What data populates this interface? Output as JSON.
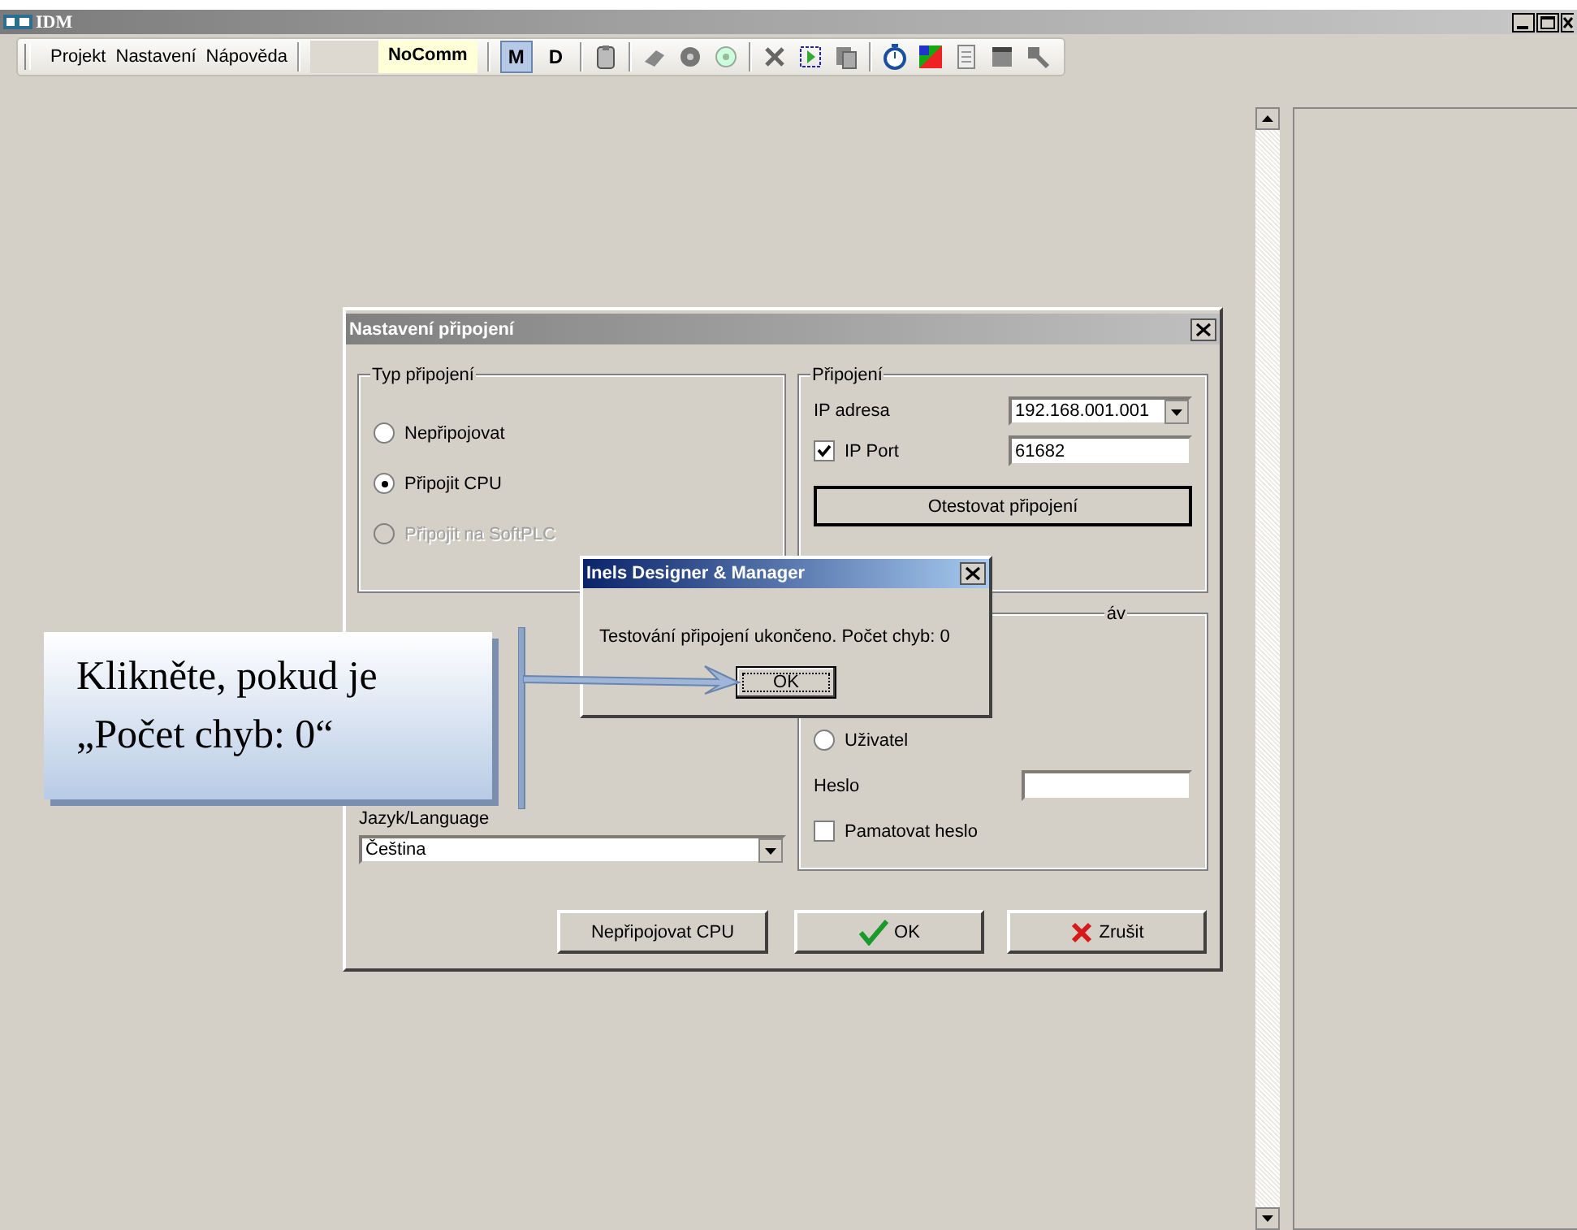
{
  "window": {
    "title": "IDM"
  },
  "menu": [
    {
      "label": "Projekt"
    },
    {
      "label": "Nastavení"
    },
    {
      "label": "Nápověda"
    }
  ],
  "comm_status": "NoComm",
  "mode_buttons": [
    {
      "label": "M",
      "selected": true
    },
    {
      "label": "D",
      "selected": false
    }
  ],
  "dialog": {
    "title": "Nastavení připojení",
    "connection_type": {
      "title": "Typ připojení",
      "options": [
        {
          "label": "Nepřipojovat",
          "selected": false,
          "disabled": false
        },
        {
          "label": "Připojit CPU",
          "selected": true,
          "disabled": false
        },
        {
          "label": "Připojit na SoftPLC",
          "selected": false,
          "disabled": true
        }
      ]
    },
    "connection": {
      "title": "Připojení",
      "ip_label": "IP adresa",
      "ip_value": "192.168.001.001",
      "port": {
        "label": "IP Port",
        "checked": true,
        "value": "61682"
      },
      "test_button": "Otestovat připojení"
    },
    "access": {
      "title": "áv",
      "user": {
        "label": "Uživatel",
        "selected": false
      },
      "password_label": "Heslo",
      "remember": {
        "label": "Pamatovat heslo",
        "checked": false
      }
    },
    "language": {
      "label": "Jazyk/Language",
      "value": "Čeština"
    },
    "buttons": [
      {
        "kind": "plain",
        "label": "Nepřipojovat CPU"
      },
      {
        "kind": "ok",
        "label": "OK"
      },
      {
        "kind": "cancel",
        "label": "Zrušit"
      }
    ]
  },
  "message_box": {
    "title": "Inels Designer & Manager",
    "text": "Testování připojení ukončeno. Počet chyb: 0",
    "button": "OK"
  },
  "callout": {
    "text": "Klikněte, pokud je „Počet chyb: 0“"
  }
}
